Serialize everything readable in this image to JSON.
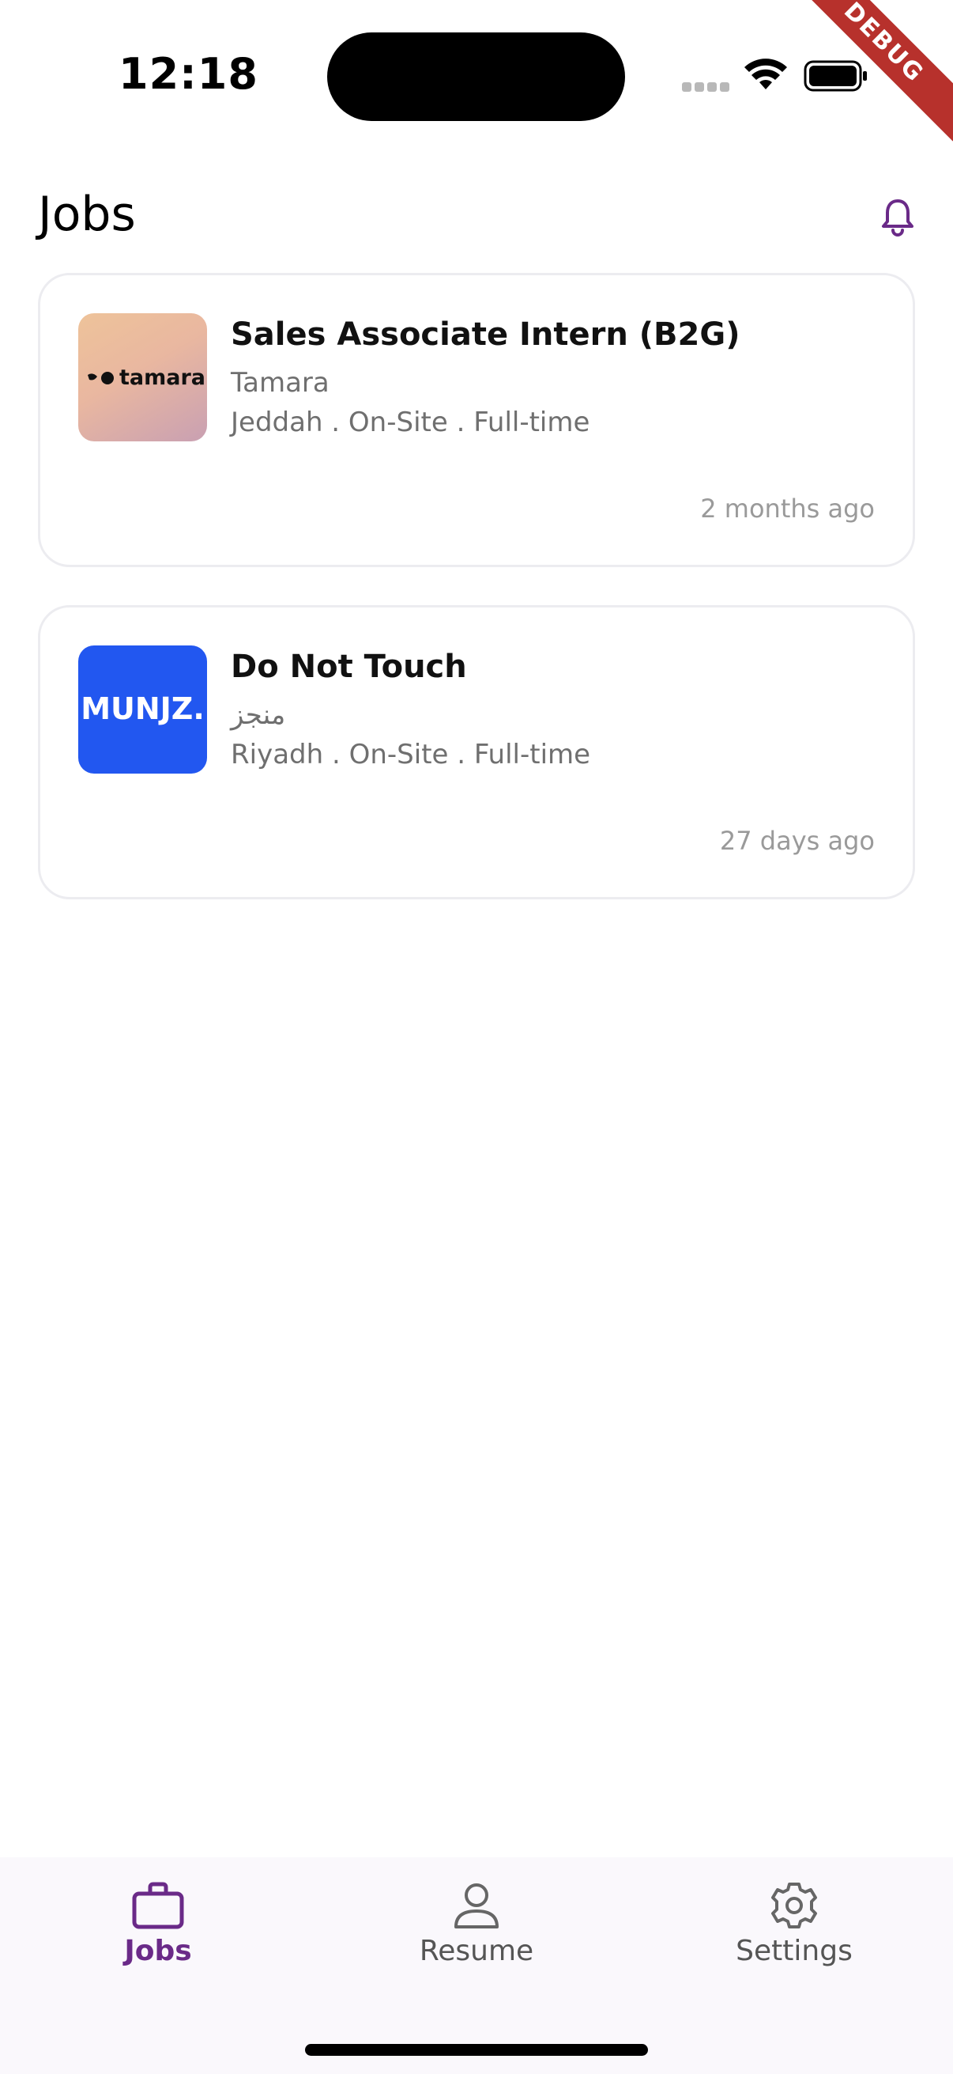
{
  "status_bar": {
    "time": "12:18",
    "debug_label": "DEBUG"
  },
  "header": {
    "title": "Jobs",
    "bell_icon": "bell-icon",
    "accent_color": "#6a2a88"
  },
  "jobs": [
    {
      "title": "Sales Associate Intern (B2G)",
      "company": "Tamara",
      "meta": "Jeddah . On-Site . Full-time",
      "posted": "2 months ago",
      "logo_text": "tamara"
    },
    {
      "title": "Do Not Touch",
      "company": "منجز",
      "meta": "Riyadh . On-Site . Full-time",
      "posted": "27 days ago",
      "logo_text": "MUNJZ.",
      "logo_color": "#2257f0"
    }
  ],
  "bottom_nav": {
    "items": [
      {
        "label": "Jobs",
        "icon": "briefcase-icon",
        "active": true
      },
      {
        "label": "Resume",
        "icon": "person-icon",
        "active": false
      },
      {
        "label": "Settings",
        "icon": "gear-icon",
        "active": false
      }
    ]
  }
}
